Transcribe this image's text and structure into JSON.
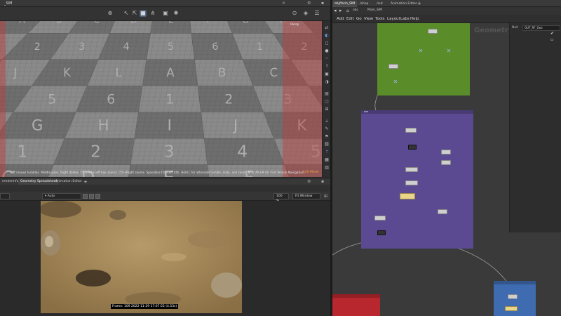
{
  "viewport": {
    "tab_label": "_SIM",
    "persp_label": "Persp",
    "hint_text": "Left mouse tumbles. Middle pans. Right dollies. Ctrl+Alt+Left box zooms. Ctrl+Right zooms. Spacebar-Ctrl-Left tilts. Hold L for alternate tumble, dolly, and zoom.    M or Alt+M for First Person Navigation.",
    "mode_label": "Edit Mode",
    "checker_letters": [
      "A",
      "B",
      "C",
      "D",
      "E",
      "F",
      "G",
      "H",
      "I",
      "J",
      "K",
      "L"
    ],
    "checker_numbers": [
      "1",
      "2",
      "3",
      "4",
      "5",
      "6"
    ]
  },
  "lower_panel": {
    "tabs": [
      "renderInfo",
      "Geometry Spreadsheet",
      "Animation Editor"
    ],
    "auto_label": "Auto",
    "zoom_label": "100 %",
    "fit_label": "Fit Window",
    "frame_info": "Frame: 109  2022-11-29 17:07:55  (4.53s)"
  },
  "network": {
    "tabs": [
      "obj/farm_SIM",
      "/shop",
      "/out",
      "Animation Editor"
    ],
    "path_label": "obj",
    "path_node": "Main_SIM",
    "menu": [
      "Add",
      "Edit",
      "Go",
      "View",
      "Tools",
      "Layout",
      "Labs",
      "Help"
    ],
    "geometry_label": "Geometry",
    "param_label": "Null",
    "param_value": "OUT_RF_Geo",
    "purple_label": "sim",
    "colors": {
      "green": "#5a8c2a",
      "purple": "#5b4a91",
      "red": "#b8262e",
      "blue": "#3f6bb0"
    }
  }
}
